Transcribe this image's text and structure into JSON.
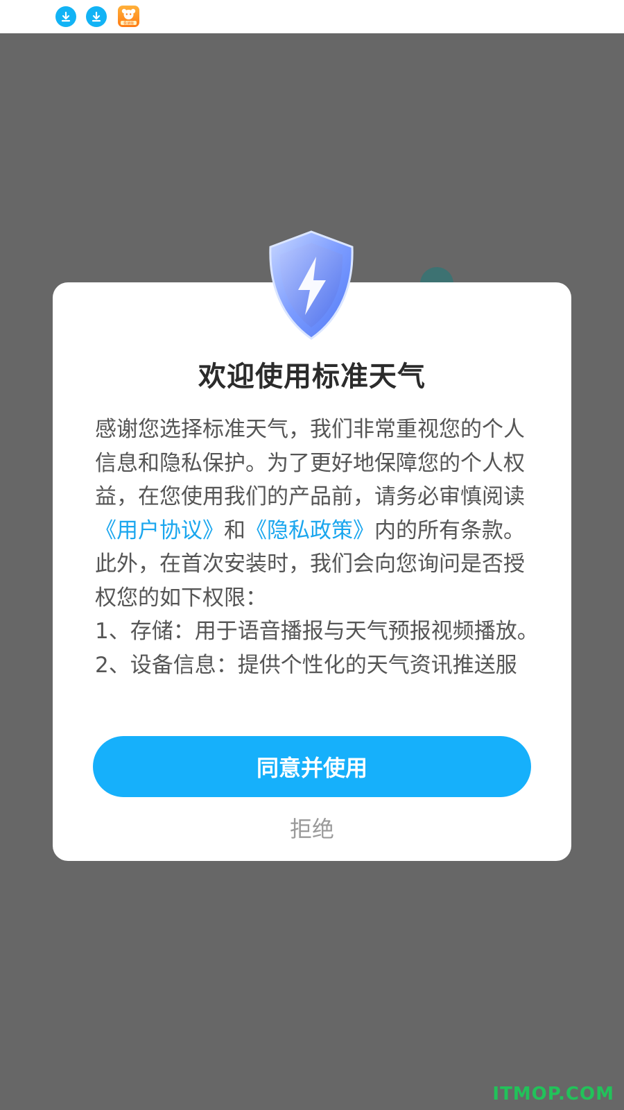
{
  "statusbar": {
    "icons": [
      "download-icon",
      "download-icon",
      "app-notification-icon"
    ],
    "app_icon_label": "极速版"
  },
  "dialog": {
    "title": "欢迎使用标准天气",
    "intro_1": "感谢您选择标准天气，我们非常重视您的个人信息和隐私保护。为了更好地保障您的个人权益，在您使用我们的产品前，请务必审慎阅读",
    "user_agreement_link": "《用户协议》",
    "and": "和",
    "privacy_policy_link": "《隐私政策》",
    "intro_2": "内的所有条款。此外，在首次安装时，我们会向您询问是否授权您的如下权限：",
    "permission_1": "1、存储：用于语音播报与天气预报视频播放。",
    "permission_2": "2、设备信息：提供个性化的天气资讯推送服",
    "agree_button": "同意并使用",
    "reject_button": "拒绝"
  },
  "watermark": "ITMOP.COM",
  "colors": {
    "accent": "#16b0fb",
    "link": "#1aa6ee",
    "overlay": "#676767"
  }
}
